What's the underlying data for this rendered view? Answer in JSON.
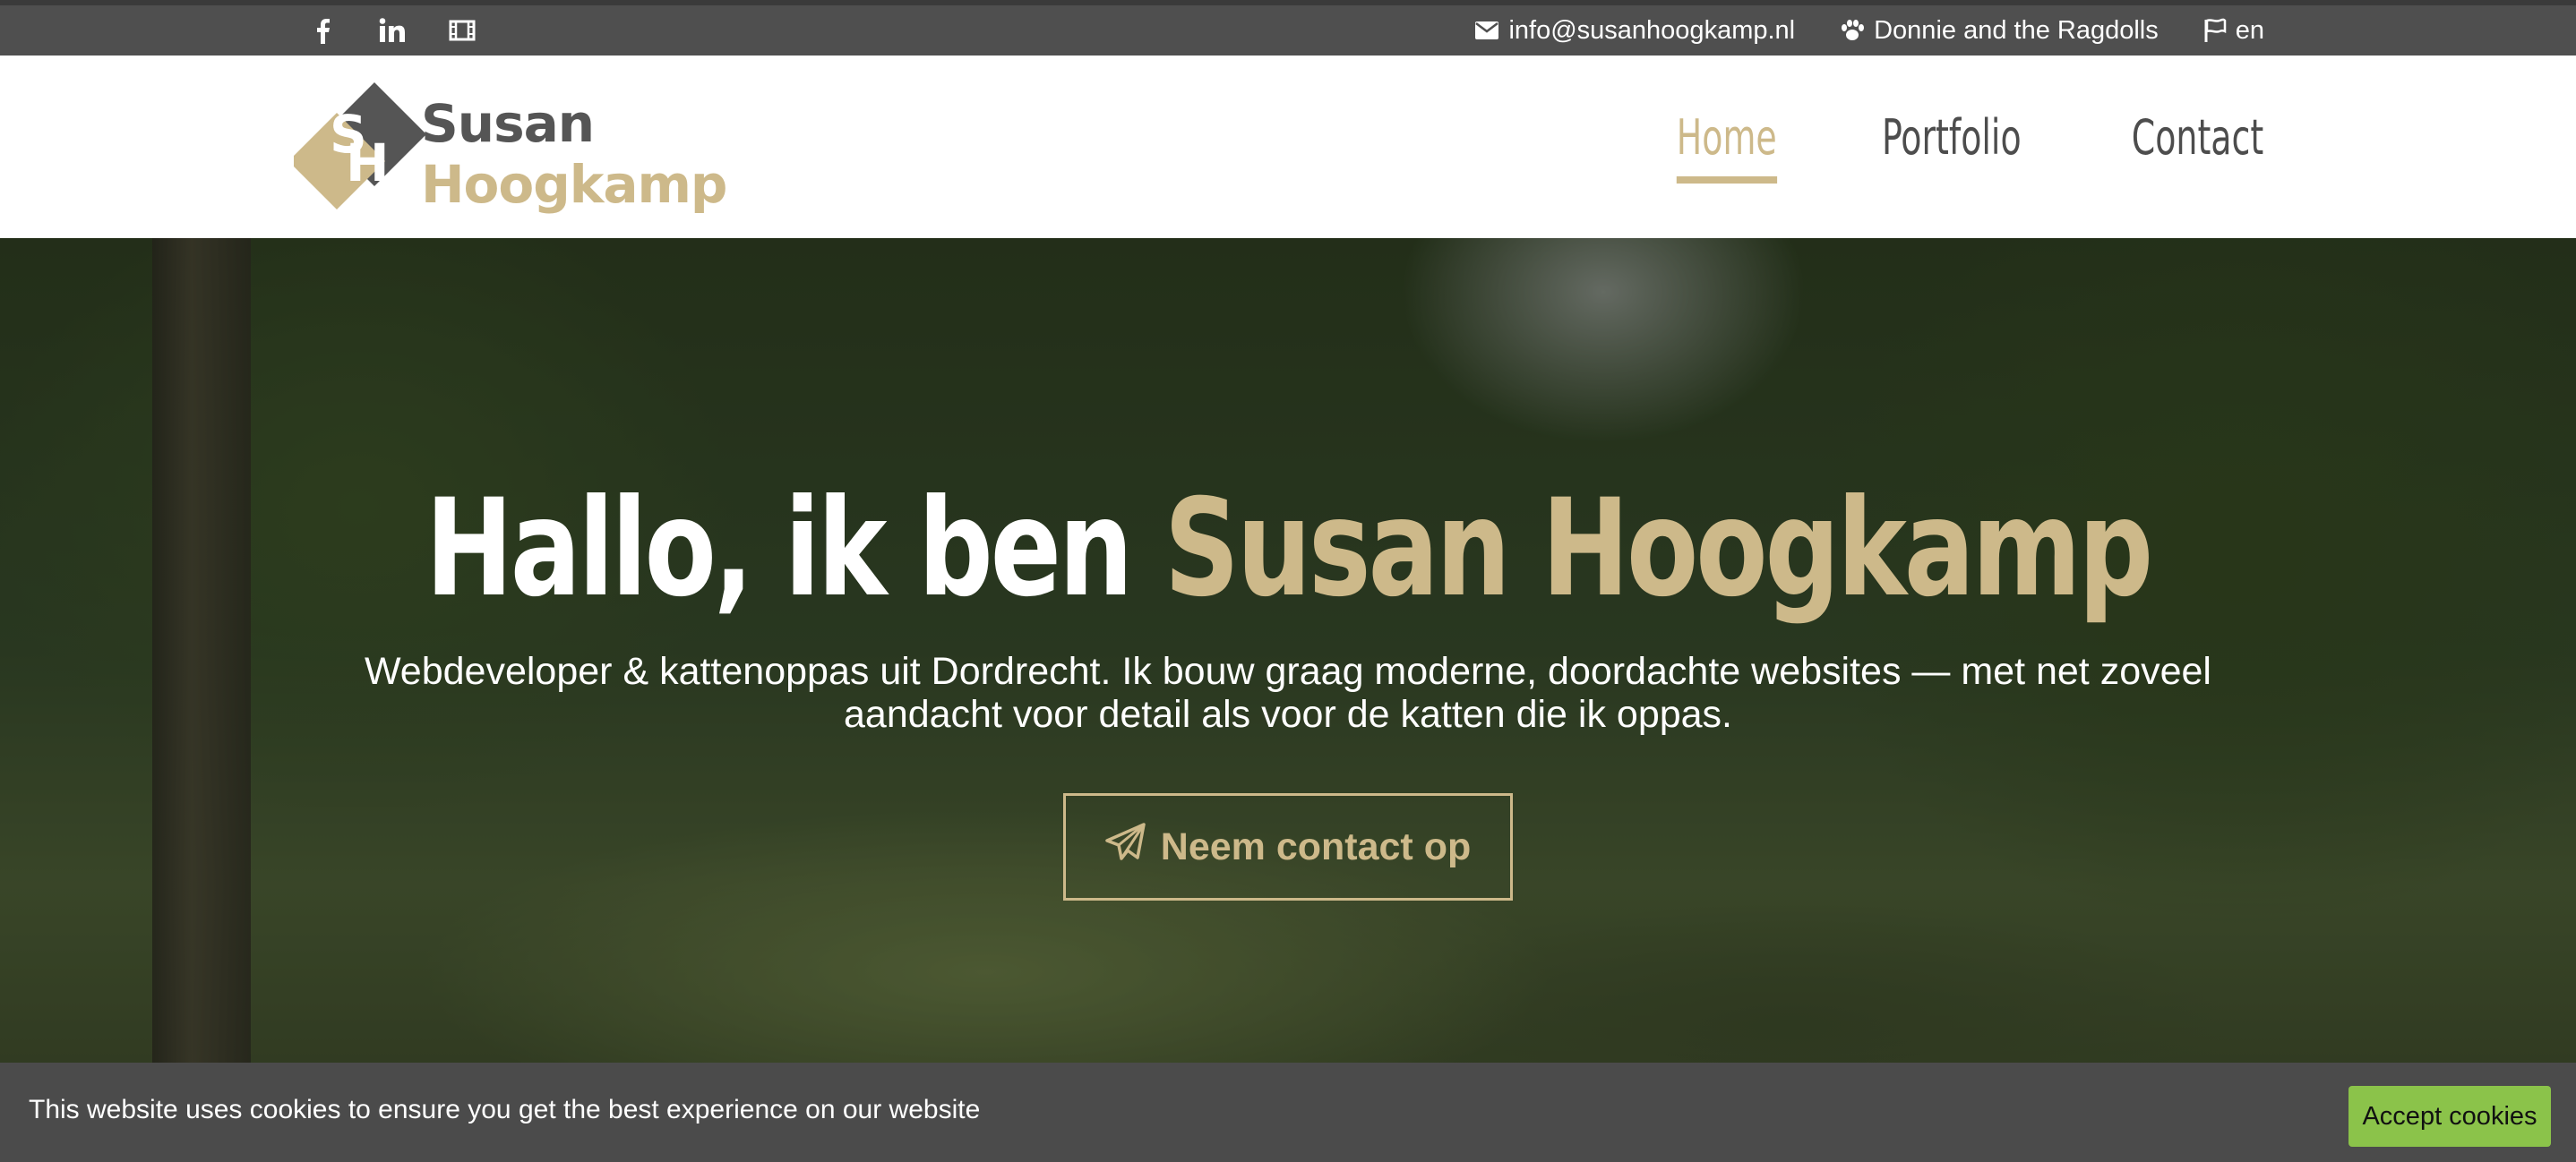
{
  "topbar": {
    "social_icons": [
      "facebook-icon",
      "linkedin-icon",
      "film-icon"
    ],
    "email": "info@susanhoogkamp.nl",
    "cats_link": "Donnie and the Ragdolls",
    "language": "en"
  },
  "header": {
    "logo_initials": "SH",
    "logo_line1": "Susan",
    "logo_line2": "Hoogkamp",
    "nav": [
      {
        "label": "Home",
        "active": true
      },
      {
        "label": "Portfolio",
        "active": false
      },
      {
        "label": "Contact",
        "active": false
      }
    ]
  },
  "hero": {
    "title_prefix": "Hallo, ik ben ",
    "title_name": "Susan Hoogkamp",
    "subtitle": "Webdeveloper & kattenoppas uit Dordrecht. Ik bouw graag moderne, doordachte websites — met net zoveel aandacht voor detail als voor de katten die ik oppas.",
    "cta_label": "Neem contact op",
    "cta_icon": "paper-plane-icon"
  },
  "cookie_bar": {
    "message": "This website uses cookies to ensure you get the best experience on our website",
    "accept_label": "Accept cookies"
  },
  "colors": {
    "accent": "#cdb98a",
    "dark": "#4f4f4f",
    "accept_green": "#8bc34a"
  }
}
